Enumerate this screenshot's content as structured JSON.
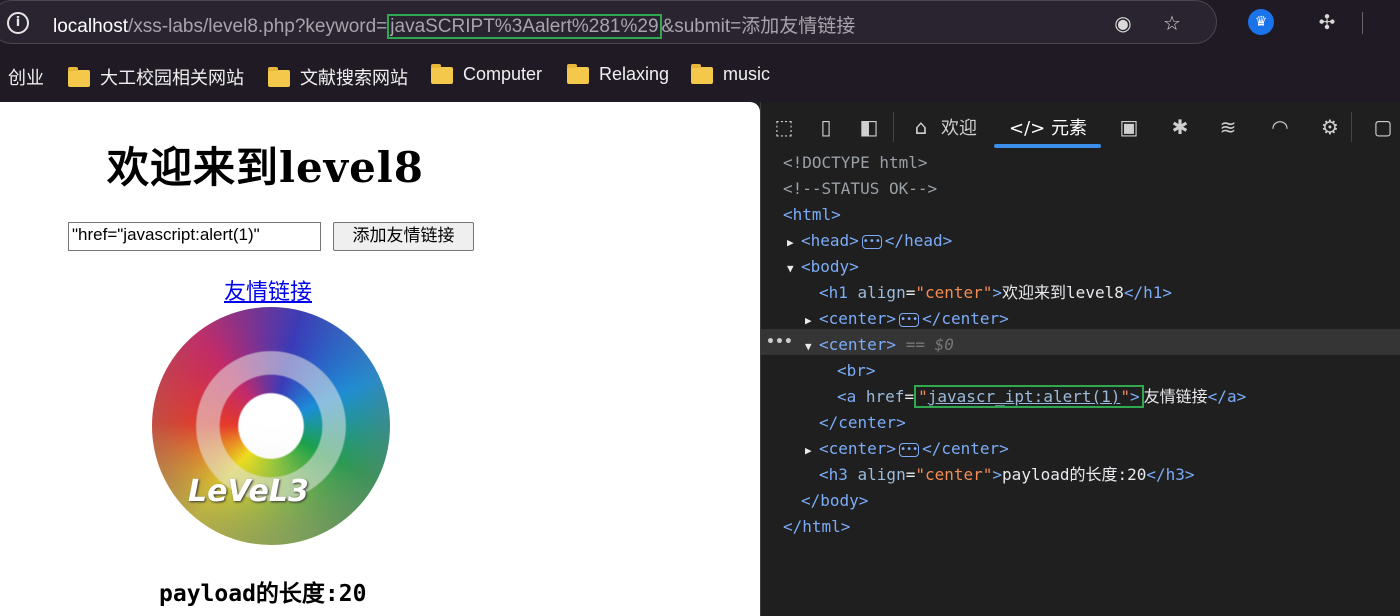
{
  "browser": {
    "url_host": "localhost",
    "url_path_prefix": "/xss-labs/level8.php?keyword=",
    "url_keyword": "javaSCRIPT%3Aalert%281%29",
    "url_suffix": "&submit=添加友情链接",
    "icons": [
      "info-icon",
      "edge-copilot-icon",
      "favorite-star-icon",
      "extension-badge-icon",
      "puzzle-extensions-icon"
    ]
  },
  "bookmarks": [
    {
      "label": "创业",
      "folder": false
    },
    {
      "label": "大工校园相关网站",
      "folder": true
    },
    {
      "label": "文献搜索网站",
      "folder": true
    },
    {
      "label": "Computer",
      "folder": true
    },
    {
      "label": "Relaxing",
      "folder": true
    },
    {
      "label": "music",
      "folder": true
    }
  ],
  "page": {
    "heading": "欢迎来到level8",
    "keyword_value": "\"href=\"javascript:alert(1)\"",
    "submit_label": "添加友情链接",
    "friend_link": "友情链接",
    "image_text": "LeVeL3",
    "payload_length": "payload的长度:20"
  },
  "devtools": {
    "tabs": {
      "welcome": "欢迎",
      "elements": "元素"
    },
    "dom": {
      "doctype": "<!DOCTYPE html>",
      "comment": "<!--STATUS OK-->",
      "html_open": "<html>",
      "head_open": "<head>",
      "head_close": "</head>",
      "body_open": "<body>",
      "h1_open": "<h1 ",
      "h1_attr": "align",
      "h1_val": "\"center\"",
      "h1_text": "欢迎来到level8",
      "h1_close": "</h1>",
      "center_open": "<center>",
      "center_close": "</center>",
      "selected_marker": "== $0",
      "br": "<br>",
      "a_open": "<a ",
      "a_attr": "href",
      "a_val": "javascr_ipt:alert(1)",
      "a_text": "友情链接",
      "a_close": "</a>",
      "h3_open": "<h3 ",
      "h3_attr": "align",
      "h3_val": "\"center\"",
      "h3_text": "payload的长度:20",
      "h3_close": "</h3>",
      "body_close": "</body>",
      "html_close": "</html>"
    }
  }
}
